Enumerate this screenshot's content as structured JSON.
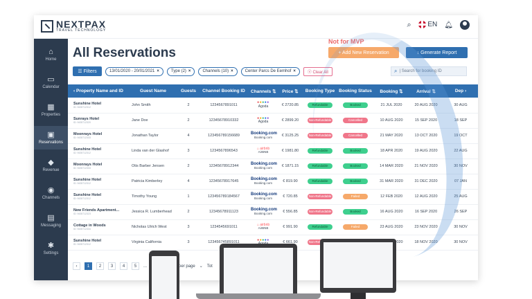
{
  "brand": {
    "name": "NEXTPAX",
    "tagline": "TRAVEL TECHNOLOGY"
  },
  "header": {
    "search_icon": "search-icon",
    "flag_icon": "uk-flag-icon",
    "language": "EN",
    "bell_icon": "bell-icon",
    "avatar_icon": "user-avatar-icon"
  },
  "sidebar": {
    "items": [
      {
        "label": "Home",
        "icon": "⌂"
      },
      {
        "label": "Calendar",
        "icon": "▭"
      },
      {
        "label": "Properties",
        "icon": "▦"
      },
      {
        "label": "Reservations",
        "icon": "▣"
      },
      {
        "label": "Revenue",
        "icon": "◆"
      },
      {
        "label": "Channels",
        "icon": "◉"
      },
      {
        "label": "Messaging",
        "icon": "▤"
      },
      {
        "label": "Settings",
        "icon": "✱"
      }
    ],
    "active": "Reservations"
  },
  "page": {
    "title": "All Reservations",
    "not_mvp": "Not for MVP",
    "add_button": "+ Add New Reservation",
    "report_button": "↓ Generate Report",
    "filters_button": "☰ Filters",
    "chips": [
      "13/01/2020 - 20/01/2021",
      "Type (2)",
      "Channels (10)",
      "Center Parcs De Eemhof"
    ],
    "clear_all": "ⓧ Clear All",
    "search_placeholder": "| Search for booking ID"
  },
  "table": {
    "headers": [
      "Property Name and ID",
      "Guest Name",
      "Guests",
      "Channel Booking ID",
      "Channels",
      "Price",
      "Booking Type",
      "Booking Status",
      "Booking",
      "Arrival",
      "Dep"
    ],
    "rows": [
      {
        "property": "Sunshine Hotel",
        "pid": "ID: 9435712312",
        "guest": "John Smith",
        "guests": "2",
        "cbid": "1234567891011",
        "channel": "agoda",
        "price": "€ 2720.85",
        "type": "Refundable",
        "status": "Booked",
        "booking": "21 JUL 2020",
        "arrival": "20 AUG 2020",
        "dep": "30 AUG"
      },
      {
        "property": "Sunrays Hotel",
        "pid": "ID: 9435712320",
        "guest": "Jane Doe",
        "guests": "2",
        "cbid": "12345678910332",
        "channel": "agoda",
        "price": "€ 2899.20",
        "type": "Non-Refundable",
        "status": "Cancelled",
        "booking": "10 AUG 2020",
        "arrival": "15 SEP 2020",
        "dep": "18 SEP"
      },
      {
        "property": "Moonrays Hotel",
        "pid": "ID: 9435712333",
        "guest": "Jonathan Taylor",
        "guests": "4",
        "cbid": "123456789156689",
        "channel": "booking",
        "price": "€ 3125.25",
        "type": "Non-Refundable",
        "status": "Cancelled",
        "booking": "21 MAY 2020",
        "arrival": "13 OCT 2020",
        "dep": "19 OCT"
      },
      {
        "property": "Sunshine Hotel",
        "pid": "ID: 9435712312",
        "guest": "Linda van der Glashof",
        "guests": "3",
        "cbid": "1234567896543",
        "channel": "airbnb",
        "price": "€ 1981.80",
        "type": "Refundable",
        "status": "Booked",
        "booking": "18 APR 2020",
        "arrival": "19 AUG 2020",
        "dep": "22 AUG"
      },
      {
        "property": "Moonrays Hotel",
        "pid": "ID: 9435712333",
        "guest": "Otis Barber Jensen",
        "guests": "2",
        "cbid": "12345678912344",
        "channel": "booking",
        "price": "€ 1871.15",
        "type": "Refundable",
        "status": "Booked",
        "booking": "14 MAR 2020",
        "arrival": "21 NOV 2020",
        "dep": "30 NOV"
      },
      {
        "property": "Sunshine Hotel",
        "pid": "ID: 9435712312",
        "guest": "Patricia Kimberley",
        "guests": "4",
        "cbid": "12345678917645",
        "channel": "booking",
        "price": "€ 819.90",
        "type": "Refundable",
        "status": "Booked",
        "booking": "31 MAR 2020",
        "arrival": "31 DEC 2020",
        "dep": "07 JAN"
      },
      {
        "property": "Sunshine Hotel",
        "pid": "ID: 9435712312",
        "guest": "Timothy Young",
        "guests": "1",
        "cbid": "123456789184567",
        "channel": "booking",
        "price": "€ 720.85",
        "type": "Non-Refundable",
        "status": "Failed",
        "booking": "12 FEB 2020",
        "arrival": "12 AUG 2020",
        "dep": "25 AUG"
      },
      {
        "property": "New Friends Apartment...",
        "pid": "ID: 9435712323",
        "guest": "Jessica R. Lumberhead",
        "guests": "2",
        "cbid": "12345678911123",
        "channel": "booking",
        "price": "€ 556.85",
        "type": "Non-Refundable",
        "status": "Booked",
        "booking": "16 AUG 2020",
        "arrival": "16 SEP 2020",
        "dep": "26 SEP"
      },
      {
        "property": "Cottage in Woods",
        "pid": "ID: 9435712334",
        "guest": "Nicholas Ulrich West",
        "guests": "3",
        "cbid": "1234545691011",
        "channel": "airbnb",
        "price": "€ 991.90",
        "type": "Refundable",
        "status": "Failed",
        "booking": "23 AUG 2020",
        "arrival": "23 NOV 2020",
        "dep": "30 NOV"
      },
      {
        "property": "Sunshine Hotel",
        "pid": "ID: 9435712312",
        "guest": "Virginia California",
        "guests": "3",
        "cbid": "123456745891011",
        "channel": "agoda",
        "price": "€ 661.90",
        "type": "Non-Refundable",
        "status": "Booked",
        "booking": "20 AUG 2020",
        "arrival": "18 NOV 2020",
        "dep": "30 NOV"
      }
    ]
  },
  "channels": {
    "agoda": "Agoda",
    "booking": "Booking.com",
    "booking_sub": "Booking.com",
    "airbnb": "airbnb",
    "airbnb_sub": "AirBNB"
  },
  "pager": {
    "pages": [
      "1",
      "2",
      "3",
      "4",
      "5"
    ],
    "ellipsis": "...",
    "per_page": "per page",
    "total": "Tot"
  },
  "colors": {
    "primary": "#2f6fb0",
    "sidebar": "#2c3b4e",
    "accent_orange": "#f6a96a",
    "accent_red": "#f0768a",
    "accent_green": "#3ecf8e"
  }
}
